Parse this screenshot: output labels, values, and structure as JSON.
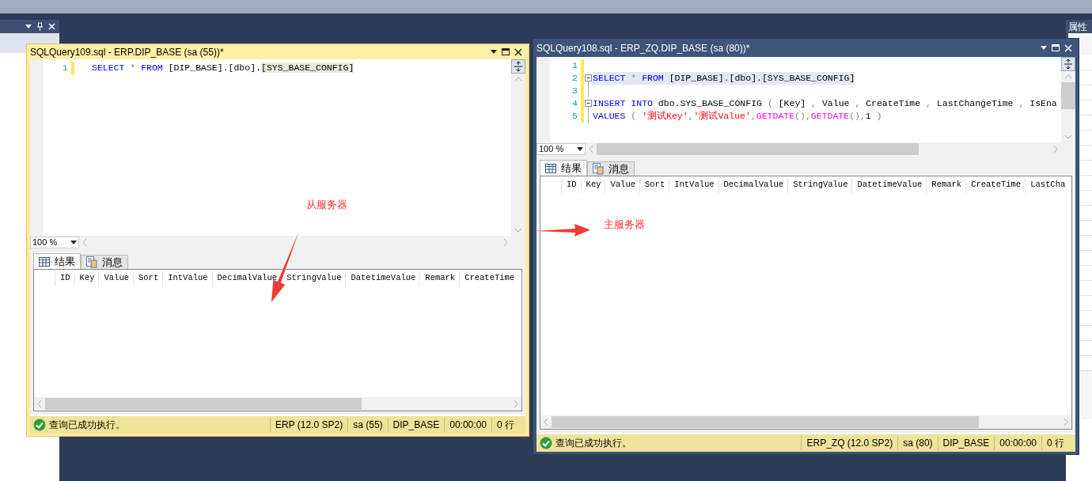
{
  "side_panel": {
    "title": "属性"
  },
  "windows": [
    {
      "title": "SQLQuery109.sql - ERP.DIP_BASE (sa (55))*",
      "active": true,
      "lines": [
        {
          "number": "1",
          "kind": "plain",
          "highlighted": false,
          "tokens": [
            {
              "kind": "keyword",
              "text": "SELECT"
            },
            {
              "kind": "operator",
              "text": " * "
            },
            {
              "kind": "keyword",
              "text": "FROM"
            },
            {
              "kind": "plain",
              "text": " [DIP_BASE].[dbo]."
            },
            {
              "kind": "match",
              "text": "[SYS_BASE_CONFIG]"
            }
          ]
        }
      ],
      "zoom": "100 %",
      "tabs": [
        {
          "label": "结果",
          "selected": true
        },
        {
          "label": "消息",
          "selected": false
        }
      ],
      "columns": [
        "ID",
        "Key",
        "Value",
        "Sort",
        "IntValue",
        "DecimalValue",
        "StringValue",
        "DatetimeValue",
        "Remark",
        "CreateTime"
      ],
      "status": {
        "message": "查询已成功执行。",
        "fields": [
          "ERP (12.0 SP2)",
          "sa (55)",
          "DIP_BASE",
          "00:00:00",
          "0 行"
        ]
      }
    },
    {
      "title": "SQLQuery108.sql - ERP_ZQ.DIP_BASE (sa (80))*",
      "active": false,
      "lines": [
        {
          "number": "1",
          "kind": "plain",
          "highlighted": false
        },
        {
          "number": "2",
          "kind": "fold-start",
          "highlighted": true,
          "tokens": [
            {
              "kind": "keyword",
              "text": "SELECT"
            },
            {
              "kind": "operator",
              "text": " * "
            },
            {
              "kind": "keyword",
              "text": "FROM"
            },
            {
              "kind": "plain",
              "text": " [DIP_BASE].[dbo].[SYS_BASE_CONFIG]"
            }
          ]
        },
        {
          "number": "3",
          "kind": "fold-line",
          "highlighted": false
        },
        {
          "number": "4",
          "kind": "fold-start",
          "highlighted": false,
          "tokens": [
            {
              "kind": "keyword",
              "text": "INSERT"
            },
            {
              "kind": "keyword",
              "text": " INTO"
            },
            {
              "kind": "plain",
              "text": " dbo.SYS_BASE_CONFIG "
            },
            {
              "kind": "operator",
              "text": "( "
            },
            {
              "kind": "plain",
              "text": "[Key] "
            },
            {
              "kind": "operator",
              "text": ", "
            },
            {
              "kind": "plain",
              "text": "Value "
            },
            {
              "kind": "operator",
              "text": ", "
            },
            {
              "kind": "plain",
              "text": "CreateTime "
            },
            {
              "kind": "operator",
              "text": ", "
            },
            {
              "kind": "plain",
              "text": "LastChangeTime "
            },
            {
              "kind": "operator",
              "text": ", "
            },
            {
              "kind": "plain",
              "text": "IsEna"
            }
          ]
        },
        {
          "number": "5",
          "kind": "fold-line",
          "highlighted": false,
          "tokens": [
            {
              "kind": "keyword",
              "text": "VALUES"
            },
            {
              "kind": "operator",
              "text": " ( "
            },
            {
              "kind": "string",
              "text": "'测试Key'"
            },
            {
              "kind": "operator",
              "text": ","
            },
            {
              "kind": "string",
              "text": "'测试Value'"
            },
            {
              "kind": "operator",
              "text": ","
            },
            {
              "kind": "function",
              "text": "GETDATE"
            },
            {
              "kind": "operator",
              "text": "(),"
            },
            {
              "kind": "function",
              "text": "GETDATE"
            },
            {
              "kind": "operator",
              "text": "(),"
            },
            {
              "kind": "plain",
              "text": "1"
            },
            {
              "kind": "operator",
              "text": " )"
            }
          ]
        }
      ],
      "zoom": "100 %",
      "tabs": [
        {
          "label": "结果",
          "selected": true
        },
        {
          "label": "消息",
          "selected": false
        }
      ],
      "columns": [
        "ID",
        "Key",
        "Value",
        "Sort",
        "IntValue",
        "DecimalValue",
        "StringValue",
        "DatetimeValue",
        "Remark",
        "CreateTime",
        "LastCha"
      ],
      "status": {
        "message": "查询已成功执行。",
        "fields": [
          "ERP_ZQ (12.0 SP2)",
          "sa (80)",
          "DIP_BASE",
          "00:00:00",
          "0 行"
        ]
      }
    }
  ],
  "annotations": [
    {
      "text": "从服务器"
    },
    {
      "text": "主服务器"
    }
  ]
}
